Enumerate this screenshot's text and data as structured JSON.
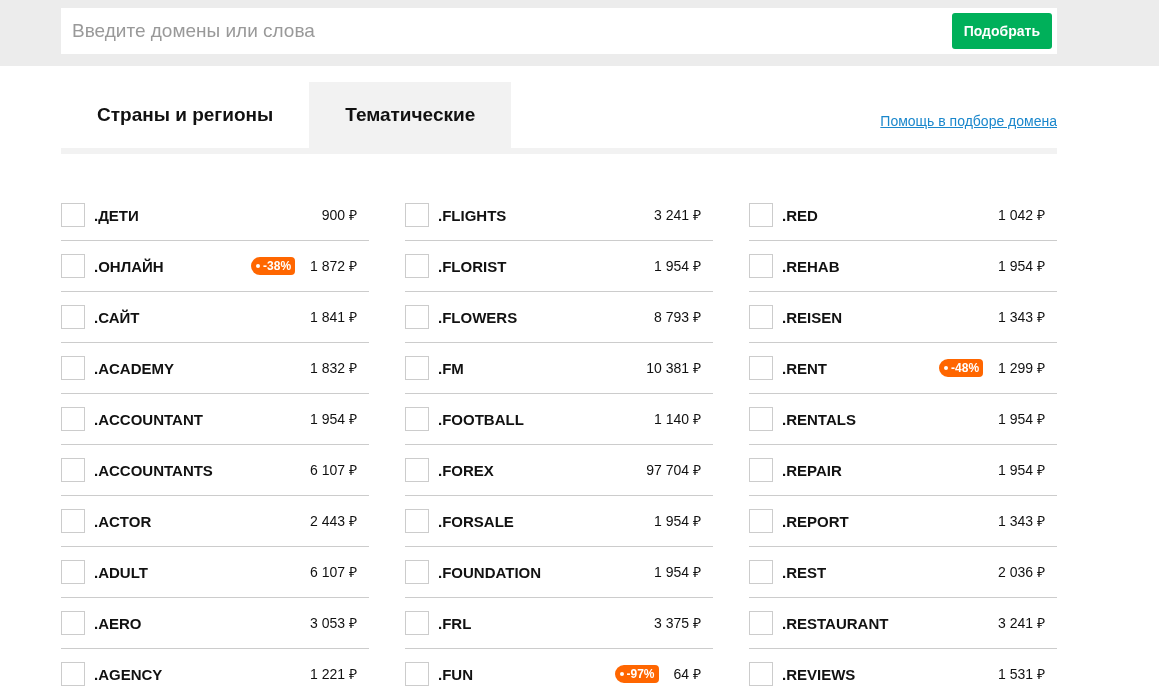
{
  "search": {
    "placeholder": "Введите домены или слова",
    "button": "Подобрать"
  },
  "tabs": [
    {
      "label": "Страны и регионы",
      "selected": false
    },
    {
      "label": "Тематические",
      "selected": true
    }
  ],
  "help_link": "Помощь в подборе домена",
  "columns": [
    [
      {
        "domain": ".ДЕТИ",
        "price": "900 ₽",
        "checked": false
      },
      {
        "domain": ".ОНЛАЙН",
        "discount": "-38%",
        "price": "1 872 ₽",
        "checked": false
      },
      {
        "domain": ".САЙТ",
        "price": "1 841 ₽",
        "checked": false
      },
      {
        "domain": ".ACADEMY",
        "price": "1 832 ₽",
        "checked": false
      },
      {
        "domain": ".ACCOUNTANT",
        "price": "1 954 ₽",
        "checked": false
      },
      {
        "domain": ".ACCOUNTANTS",
        "price": "6 107 ₽",
        "checked": false
      },
      {
        "domain": ".ACTOR",
        "price": "2 443 ₽",
        "checked": false
      },
      {
        "domain": ".ADULT",
        "price": "6 107 ₽",
        "checked": false
      },
      {
        "domain": ".AERO",
        "price": "3 053 ₽",
        "checked": false
      },
      {
        "domain": ".AGENCY",
        "price": "1 221 ₽",
        "checked": false
      }
    ],
    [
      {
        "domain": ".FLIGHTS",
        "price": "3 241 ₽",
        "checked": false
      },
      {
        "domain": ".FLORIST",
        "price": "1 954 ₽",
        "checked": false
      },
      {
        "domain": ".FLOWERS",
        "price": "8 793 ₽",
        "checked": false
      },
      {
        "domain": ".FM",
        "price": "10 381 ₽",
        "checked": false
      },
      {
        "domain": ".FOOTBALL",
        "price": "1 140 ₽",
        "checked": false
      },
      {
        "domain": ".FOREX",
        "price": "97 704 ₽",
        "checked": false
      },
      {
        "domain": ".FORSALE",
        "price": "1 954 ₽",
        "checked": false
      },
      {
        "domain": ".FOUNDATION",
        "price": "1 954 ₽",
        "checked": false
      },
      {
        "domain": ".FRL",
        "price": "3 375 ₽",
        "checked": false
      },
      {
        "domain": ".FUN",
        "discount": "-97%",
        "price": "64 ₽",
        "checked": false
      }
    ],
    [
      {
        "domain": ".RED",
        "price": "1 042 ₽",
        "checked": false
      },
      {
        "domain": ".REHAB",
        "price": "1 954 ₽",
        "checked": false
      },
      {
        "domain": ".REISEN",
        "price": "1 343 ₽",
        "checked": false
      },
      {
        "domain": ".RENT",
        "discount": "-48%",
        "price": "1 299 ₽",
        "checked": false
      },
      {
        "domain": ".RENTALS",
        "price": "1 954 ₽",
        "checked": false
      },
      {
        "domain": ".REPAIR",
        "price": "1 954 ₽",
        "checked": false
      },
      {
        "domain": ".REPORT",
        "price": "1 343 ₽",
        "checked": false
      },
      {
        "domain": ".REST",
        "price": "2 036 ₽",
        "checked": false
      },
      {
        "domain": ".RESTAURANT",
        "price": "3 241 ₽",
        "checked": false
      },
      {
        "domain": ".REVIEWS",
        "price": "1 531 ₽",
        "checked": false
      }
    ]
  ]
}
